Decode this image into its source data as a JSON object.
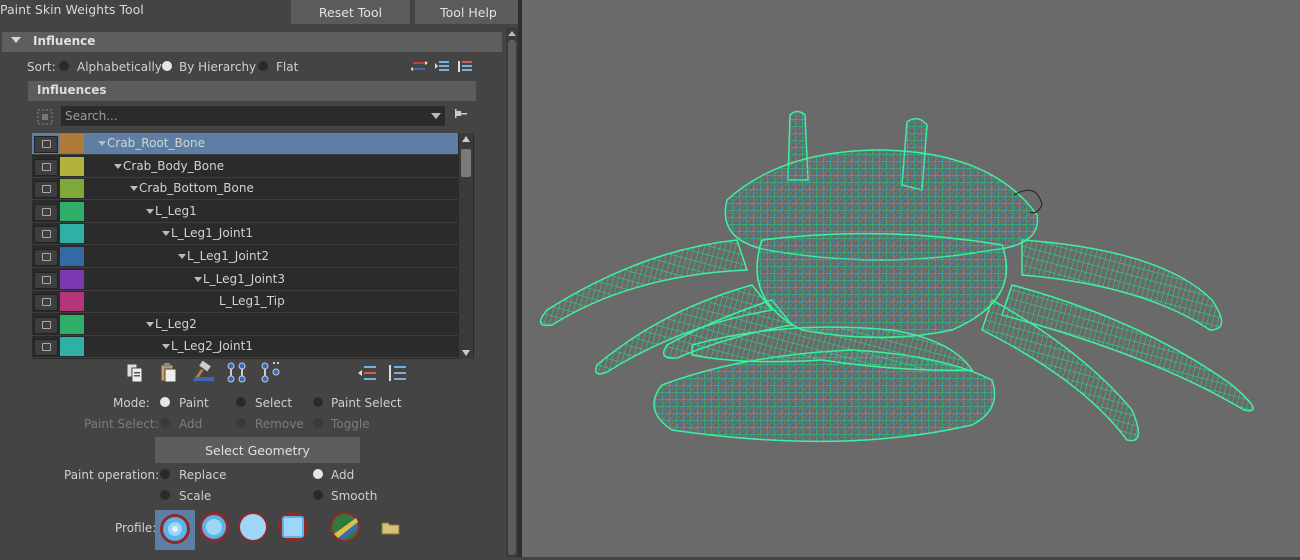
{
  "window": {
    "title": "Paint Skin Weights Tool"
  },
  "toolbar": {
    "reset_label": "Reset Tool",
    "help_label": "Tool Help"
  },
  "influence_section": {
    "label": "Influence"
  },
  "sort": {
    "label": "Sort:",
    "options": [
      "Alphabetically",
      "By Hierarchy",
      "Flat"
    ],
    "selected": "By Hierarchy"
  },
  "influences": {
    "label": "Influences",
    "search_placeholder": "Search...",
    "rows": [
      {
        "name": "Crab_Root_Bone",
        "color": "#b07a38",
        "depth": 0,
        "expanded": true,
        "selected": true
      },
      {
        "name": "Crab_Body_Bone",
        "color": "#b3b23a",
        "depth": 1,
        "expanded": true
      },
      {
        "name": "Crab_Bottom_Bone",
        "color": "#7fa83a",
        "depth": 2,
        "expanded": true
      },
      {
        "name": "L_Leg1",
        "color": "#2fae6a",
        "depth": 3,
        "expanded": true
      },
      {
        "name": "L_Leg1_Joint1",
        "color": "#2fb0a6",
        "depth": 4,
        "expanded": true
      },
      {
        "name": "L_Leg1_Joint2",
        "color": "#336aa3",
        "depth": 5,
        "expanded": true
      },
      {
        "name": "L_Leg1_Joint3",
        "color": "#7a38b3",
        "depth": 6,
        "expanded": true
      },
      {
        "name": "L_Leg1_Tip",
        "color": "#b3357a",
        "depth": 7,
        "expanded": false
      },
      {
        "name": "L_Leg2",
        "color": "#2fae6a",
        "depth": 3,
        "expanded": true
      },
      {
        "name": "L_Leg2_Joint1",
        "color": "#2fb0a6",
        "depth": 4,
        "expanded": true
      }
    ]
  },
  "mode": {
    "label": "Mode:",
    "options": [
      "Paint",
      "Select",
      "Paint Select"
    ],
    "selected": "Paint"
  },
  "paint_select": {
    "label": "Paint Select:",
    "options": [
      "Add",
      "Remove",
      "Toggle"
    ]
  },
  "select_geometry_label": "Select Geometry",
  "paint_operation": {
    "label": "Paint operation:",
    "options": [
      "Replace",
      "Add",
      "Scale",
      "Smooth"
    ],
    "selected": "Add"
  },
  "profile": {
    "label": "Profile:"
  }
}
